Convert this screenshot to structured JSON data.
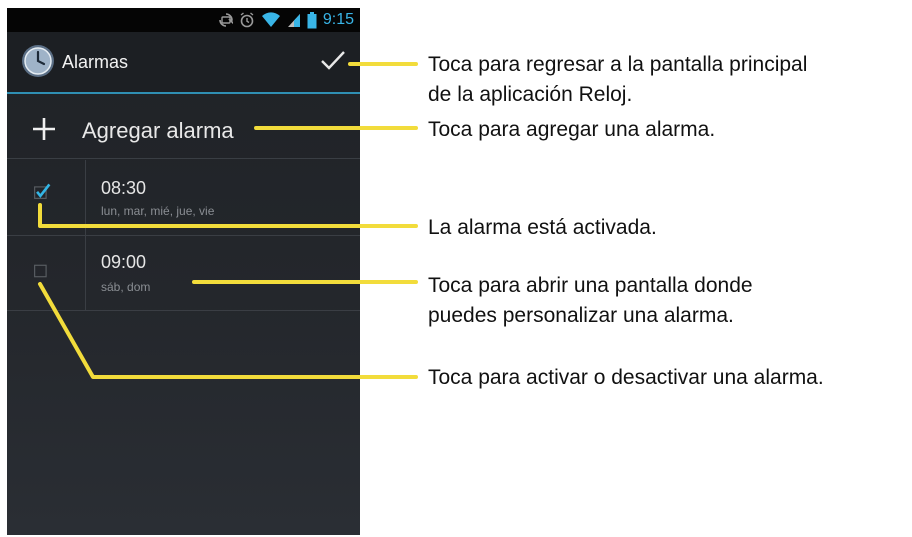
{
  "status_bar": {
    "time": "9:15",
    "icons": [
      "sync-icon",
      "alarm-icon",
      "wifi-icon",
      "signal-icon",
      "battery-icon"
    ],
    "accent_color": "#39b5e7"
  },
  "action_bar": {
    "title": "Alarmas",
    "app_icon": "clock-icon",
    "done_icon": "checkmark-icon"
  },
  "add_alarm": {
    "label": "Agregar alarma",
    "icon": "plus-icon"
  },
  "alarms": [
    {
      "time": "08:30",
      "days": "lun, mar, mié, jue, vie",
      "enabled": true
    },
    {
      "time": "09:00",
      "days": "sáb, dom",
      "enabled": false
    }
  ],
  "callouts": [
    {
      "lines": [
        "Toca para regresar a la pantalla principal",
        "de la aplicación Reloj."
      ]
    },
    {
      "lines": [
        "Toca para agregar una alarma."
      ]
    },
    {
      "lines": [
        "La alarma está activada."
      ]
    },
    {
      "lines": [
        "Toca para abrir una pantalla donde",
        "puedes personalizar una alarma."
      ]
    },
    {
      "lines": [
        "Toca para activar o desactivar una alarma."
      ]
    }
  ],
  "colors": {
    "callout_line": "#f2dc3b",
    "check": "#33b5e5"
  }
}
